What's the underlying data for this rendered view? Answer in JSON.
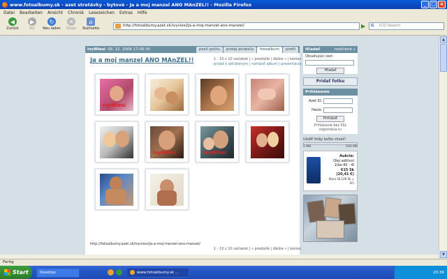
{
  "window": {
    "title": "www.fotoalbumy.sk - azet stretávky - bytové - Ja a moj manzel ANO MAnZEL!! - Mozilla Firefox"
  },
  "menu": [
    "Datei",
    "Bearbeiten",
    "Ansicht",
    "Chronik",
    "Lesezeichen",
    "Extras",
    "Hilfe"
  ],
  "toolbar": {
    "back": "Zurück",
    "forward": "Vor",
    "reload": "Neu laden",
    "stop": "Stopp",
    "home": "Startseite",
    "url": "http://fotoalbumy.azet.sk/ivyviesi/ja-a-moj-manzel-ano-manzel/",
    "search_placeholder": "ICQ Search"
  },
  "panel": {
    "user": "IvyWiesi",
    "date": "09. 12. 2006 17:00 Ut",
    "tabs": [
      "poslí počtu",
      "pridaj priateľa",
      "fotoalbum",
      "profil"
    ],
    "title": "Ja a moj manzel ANO MAnZEL!!",
    "pagination": "1 - 10 z 10  začiatok | « predošlé | ďalšie » | koniec",
    "links": "pridať k obľúbeným | nahlásiť album | prezentácia",
    "footer_url": "http://fotoalbumy.azet.sk/ivyviesi/ja-a-moj-manzel-ano-manzel/",
    "pagination_bottom": "1 - 10 z 10  začiatok | « predošlé | ďalšie » | koniec"
  },
  "photos": [
    {
      "id": 1,
      "caption": "IvyWiesi"
    },
    {
      "id": 2,
      "caption": ""
    },
    {
      "id": 3,
      "caption": ""
    },
    {
      "id": 4,
      "caption": ""
    },
    {
      "id": 5,
      "caption": ""
    },
    {
      "id": 6,
      "caption": "IvyWiesi"
    },
    {
      "id": 7,
      "caption": "IvyWiesi"
    },
    {
      "id": 8,
      "caption": ""
    },
    {
      "id": 9,
      "caption": ""
    },
    {
      "id": 10,
      "caption": ""
    }
  ],
  "sidebar": {
    "search_title": "Hľadať",
    "search_more": "rozšírené »",
    "search_label": "Obsahujúci text",
    "search_button": "Hľadať",
    "add_photo": "Pridať fotku",
    "login_title": "Prihlásenie",
    "login_id": "Azet ID",
    "login_pass": "Heslo",
    "login_button": "Prihlásiť",
    "login_note": "Prihlásenie bez SSL",
    "register": "registrácia.tu",
    "usage_label": "Uložiť fotky koľko chceš!",
    "usage_min": "0 MB",
    "usage_max": "500 MB",
    "ad": {
      "title": "Aukcie:",
      "name": "Olej aditívol",
      "spec": "10w-40 - 4l",
      "price_sk": "615 Sk",
      "price_eur": "(20,41 €)",
      "note": "(Kurz 30,126 Sk = 1€)"
    }
  },
  "status": "Fertig",
  "taskbar": {
    "start": "Start",
    "desktop": "Desktop",
    "window": "www.fotoalbumy.sk ...",
    "clock": "20:36"
  }
}
